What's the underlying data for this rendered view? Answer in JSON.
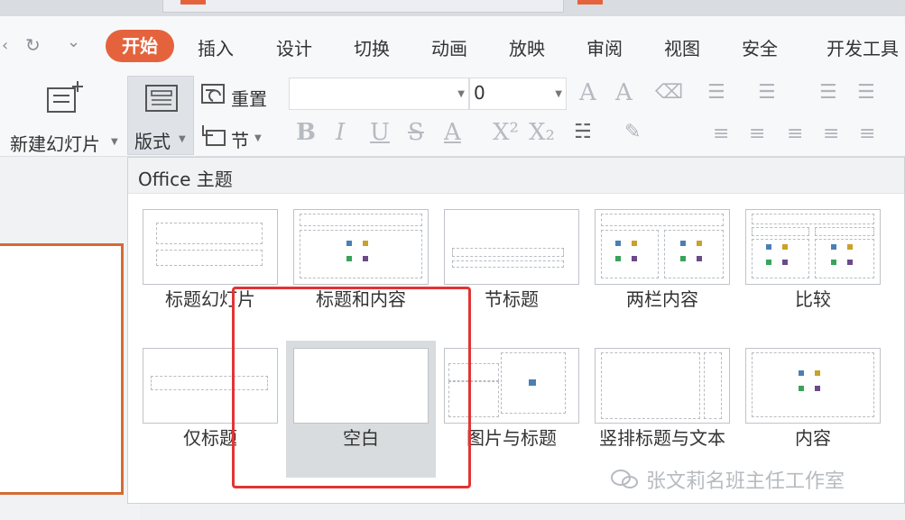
{
  "menu": {
    "items": [
      "开始",
      "插入",
      "设计",
      "切换",
      "动画",
      "放映",
      "审阅",
      "视图",
      "安全",
      "开发工具"
    ]
  },
  "ribbon": {
    "new_slide": "新建幻灯片",
    "layout": "版式",
    "reset": "重置",
    "section": "节",
    "font_size": "0"
  },
  "panel": {
    "title": "Office 主题",
    "layouts": [
      {
        "label": "标题幻灯片"
      },
      {
        "label": "标题和内容"
      },
      {
        "label": "节标题"
      },
      {
        "label": "两栏内容"
      },
      {
        "label": "比较"
      },
      {
        "label": "仅标题"
      },
      {
        "label": "空白",
        "selected": true
      },
      {
        "label": "图片与标题"
      },
      {
        "label": "竖排标题与文本"
      },
      {
        "label": "内容"
      }
    ]
  },
  "watermark": "张文莉名班主任工作室",
  "colors": {
    "accent": "#e4633d",
    "highlight_box": "#e23434",
    "slide_border": "#d46b35"
  }
}
